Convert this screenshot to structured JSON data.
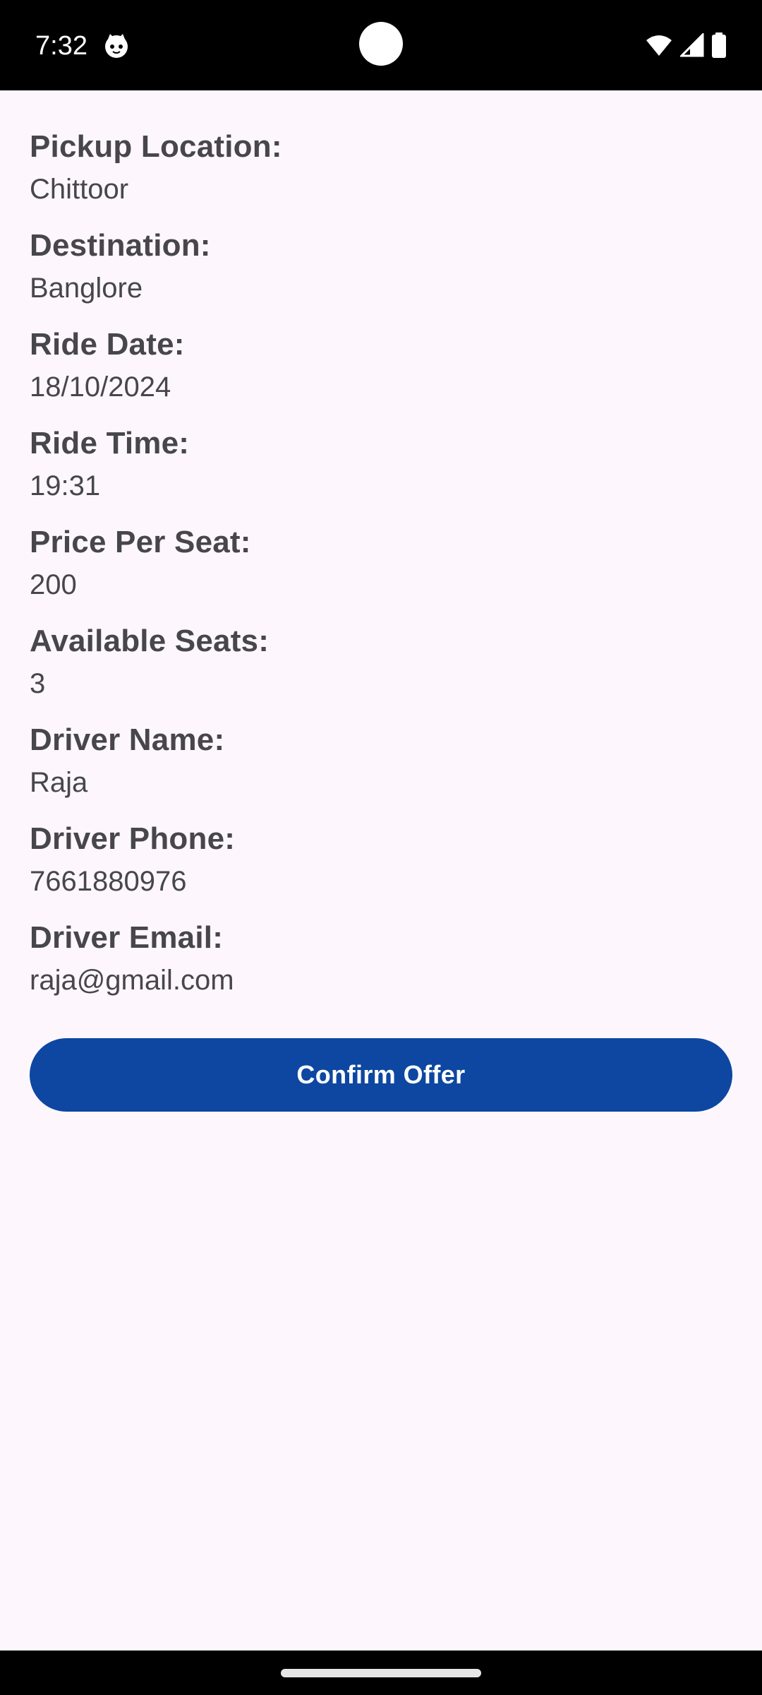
{
  "status_bar": {
    "time": "7:32",
    "app_icon": "cat-face-icon",
    "icons": [
      "wifi-icon",
      "cell-signal-icon",
      "battery-icon"
    ]
  },
  "ride": {
    "fields": [
      {
        "label": "Pickup Location:",
        "value": "Chittoor"
      },
      {
        "label": "Destination:",
        "value": "Banglore"
      },
      {
        "label": "Ride Date:",
        "value": "18/10/2024"
      },
      {
        "label": "Ride Time:",
        "value": "19:31"
      },
      {
        "label": "Price Per Seat:",
        "value": "200"
      },
      {
        "label": "Available Seats:",
        "value": "3"
      },
      {
        "label": "Driver Name:",
        "value": "Raja"
      },
      {
        "label": "Driver Phone:",
        "value": "7661880976"
      },
      {
        "label": "Driver Email:",
        "value": "raja@gmail.com"
      }
    ]
  },
  "actions": {
    "confirm_label": "Confirm Offer"
  },
  "colors": {
    "background": "#fdf7fd",
    "text": "#48464d",
    "button": "#0d47a1",
    "button_text": "#ffffff"
  }
}
